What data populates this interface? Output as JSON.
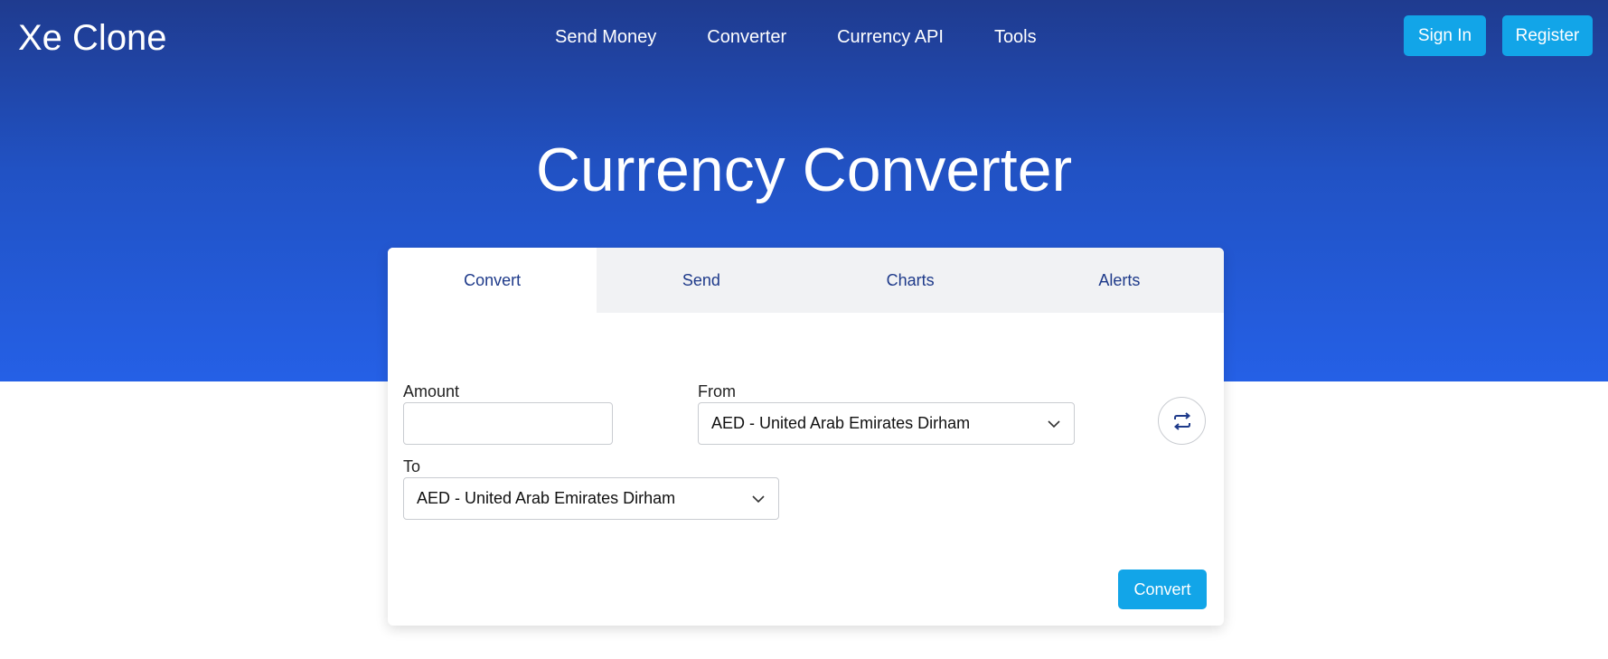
{
  "header": {
    "brand": "Xe Clone",
    "nav": [
      "Send Money",
      "Converter",
      "Currency API",
      "Tools"
    ],
    "sign_in": "Sign In",
    "register": "Register"
  },
  "hero": {
    "title": "Currency Converter"
  },
  "converter": {
    "tabs": [
      {
        "label": "Convert",
        "active": true
      },
      {
        "label": "Send",
        "active": false
      },
      {
        "label": "Charts",
        "active": false
      },
      {
        "label": "Alerts",
        "active": false
      }
    ],
    "amount_label": "Amount",
    "amount_value": "",
    "from_label": "From",
    "from_value": "AED - United Arab Emirates Dirham",
    "to_label": "To",
    "to_value": "AED - United Arab Emirates Dirham",
    "swap_icon": "swap-arrows-icon",
    "convert_button": "Convert"
  },
  "colors": {
    "hero_top": "#1f3b8f",
    "hero_bottom": "#2560e6",
    "button": "#12a5e8",
    "tab_text": "#1e3a8a"
  }
}
